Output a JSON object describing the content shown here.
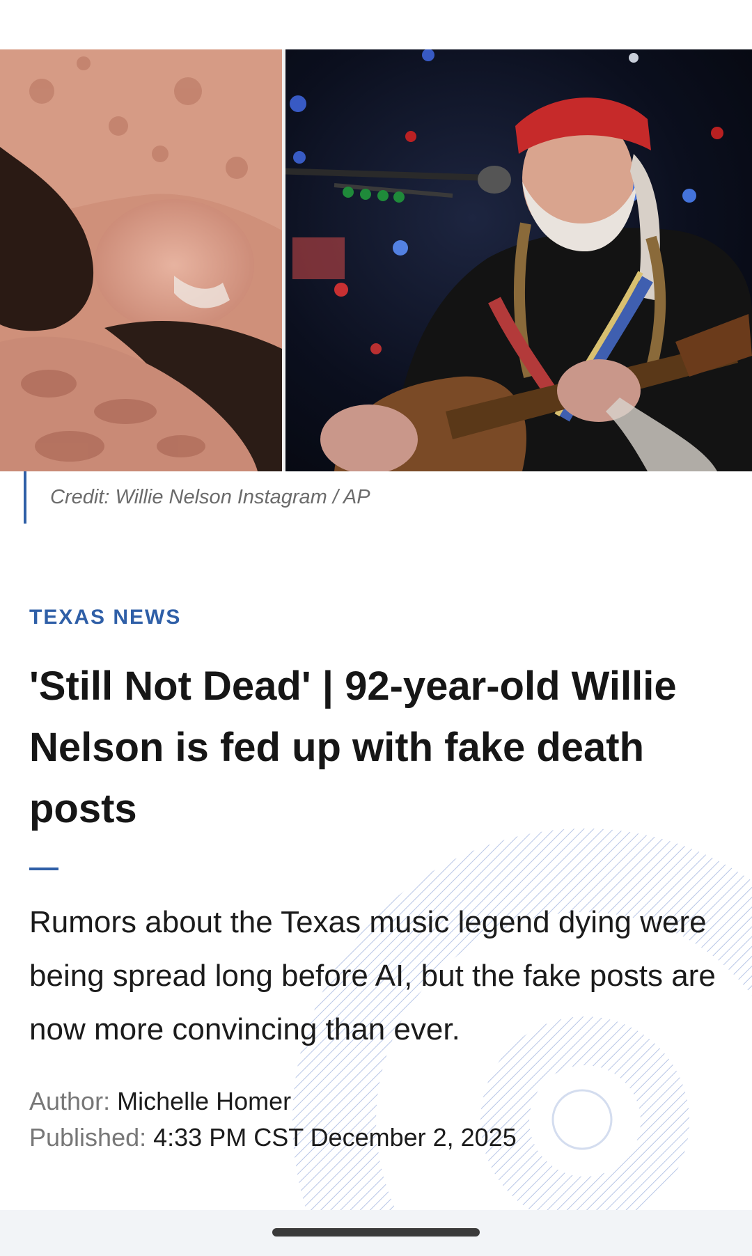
{
  "hero": {
    "image_left": "willie-nelson-instagram-photo",
    "image_right": "willie-nelson-performing-photo",
    "caption": "Credit: Willie Nelson Instagram / AP"
  },
  "article": {
    "section": "TEXAS NEWS",
    "headline": "'Still Not Dead' | 92-year-old Willie Nelson is fed up with fake death posts",
    "summary": "Rumors about the Texas music legend dying were being spread long before AI, but the fake posts are now more convincing than ever.",
    "author_label": "Author:",
    "author": "Michelle Homer",
    "published_label": "Published:",
    "published": "4:33 PM CST December 2, 2025"
  },
  "colors": {
    "accent": "#2f5fa7",
    "headline": "#161616",
    "caption": "#6b6b6b"
  }
}
